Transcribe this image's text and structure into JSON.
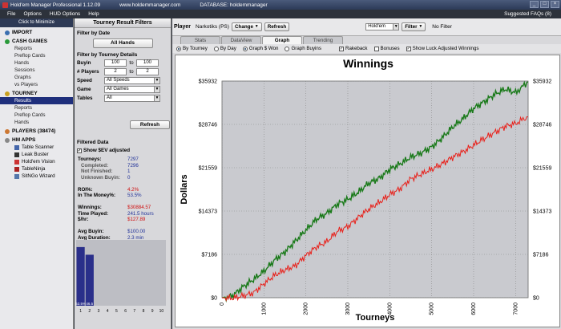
{
  "window": {
    "title": "Hold'em Manager Professional 1.12.09",
    "website": "www.holdemmanager.com",
    "database": "DATABASE: holdemmanager",
    "controls": [
      "_",
      "□",
      "×"
    ]
  },
  "menu": {
    "items": [
      "File",
      "Options",
      "HUD Options",
      "Help"
    ],
    "faq": "Suggested FAQs (8)"
  },
  "sidebar": {
    "minimize": "Click to Minimize",
    "sections": [
      {
        "label": "IMPORT",
        "color": "#3a6fb0",
        "items": []
      },
      {
        "label": "CASH GAMES",
        "color": "#2a9a3a",
        "items": [
          "Reports",
          "Preflop Cards",
          "Hands",
          "Sessions",
          "Graphs",
          "vs Players"
        ]
      },
      {
        "label": "TOURNEY",
        "color": "#c8a020",
        "items": [
          "Results",
          "Reports",
          "Preflop Cards",
          "Hands"
        ]
      },
      {
        "label": "PLAYERS (38474)",
        "color": "#cc7733",
        "items": []
      },
      {
        "label": "HM APPS",
        "color": "#888888",
        "items": []
      }
    ],
    "selected": "Results",
    "apps": [
      {
        "label": "Table Scanner",
        "color": "#4466aa"
      },
      {
        "label": "Leak Buster",
        "color": "#333333"
      },
      {
        "label": "Hold'em Vision",
        "color": "#cc3333"
      },
      {
        "label": "TableNinja",
        "color": "#aa2222"
      },
      {
        "label": "SitNGo Wizard",
        "color": "#5577aa"
      }
    ]
  },
  "filters": {
    "header": "Tourney Result Filters",
    "by_date": "Filter by Date",
    "all_hands": "All Hands",
    "details": "Filter by Tourney Details",
    "buyin_label": "Buyin",
    "buyin_from": "100",
    "buyin_to": "100",
    "players_label": "# Players",
    "players_from": "2",
    "players_to": "2",
    "to": "to",
    "speed_label": "Speed",
    "speed_value": "All Speeds",
    "game_label": "Game",
    "game_value": "All Games",
    "tables_label": "Tables",
    "tables_value": "All",
    "refresh": "Refresh"
  },
  "filtered_data": {
    "header": "Filtered Data",
    "show_sev": "Show $EV adjusted",
    "rows": [
      {
        "k": "Tourneys:",
        "v": "7297",
        "sub": false,
        "red": false
      },
      {
        "k": "Completed:",
        "v": "7296",
        "sub": true,
        "red": false
      },
      {
        "k": "Not Finished:",
        "v": "1",
        "sub": true,
        "red": false
      },
      {
        "k": "Unknown Buyin:",
        "v": "0",
        "sub": true,
        "red": false
      },
      {
        "k": "",
        "v": "",
        "sub": false,
        "red": false
      },
      {
        "k": "ROI%:",
        "v": "4.2%",
        "sub": false,
        "red": true
      },
      {
        "k": "In The Money%:",
        "v": "53.5%",
        "sub": false,
        "red": false
      },
      {
        "k": "",
        "v": "",
        "sub": false,
        "red": false
      },
      {
        "k": "Winnings:",
        "v": "$30884.57",
        "sub": false,
        "red": true
      },
      {
        "k": "Time Played:",
        "v": "241.5 hours",
        "sub": false,
        "red": false
      },
      {
        "k": "$/hr:",
        "v": "$127.89",
        "sub": false,
        "red": true
      },
      {
        "k": "",
        "v": "",
        "sub": false,
        "red": false
      },
      {
        "k": "Avg Buyin:",
        "v": "$100.00",
        "sub": false,
        "red": false
      },
      {
        "k": "Avg Duration:",
        "v": "2.3 min",
        "sub": false,
        "red": false
      }
    ],
    "finish_chart": {
      "type": "bar",
      "categories": [
        "1",
        "2",
        "3",
        "4",
        "5",
        "6",
        "7",
        "8",
        "9",
        "10"
      ],
      "values": [
        53.5,
        46.5,
        0,
        0,
        0,
        0,
        0,
        0,
        0,
        0
      ],
      "labels": [
        "53.5%",
        "46.5"
      ],
      "ylim": [
        0,
        60
      ],
      "color": "#2a2f8a"
    }
  },
  "toolbar": {
    "player_label": "Player",
    "player_name": "Narkotiks (PS)",
    "change": "Change",
    "refresh": "Refresh",
    "game": "Hold'em",
    "filter": "Filter",
    "no_filter": "No Filter"
  },
  "tabs": [
    "Stats",
    "DataView",
    "Graph",
    "Trending"
  ],
  "active_tab": "Graph",
  "options": {
    "by_tourney": "By Tourney",
    "by_day": "By Day",
    "graph_won": "Graph $ Won",
    "graph_buyins": "Graph Buyins",
    "rakeback": "Rakeback",
    "bonuses": "Bonuses",
    "luck": "Show Luck Adjusted Winnings"
  },
  "chart_data": {
    "type": "line",
    "title": "Winnings",
    "xlabel": "Tourneys",
    "ylabel": "Dollars",
    "xlim": [
      0,
      7300
    ],
    "ylim": [
      0,
      35932
    ],
    "x_ticks": [
      0,
      1000,
      2000,
      3000,
      4000,
      5000,
      6000,
      7000
    ],
    "y_ticks": [
      "$0",
      "$7186",
      "$14373",
      "$21559",
      "$28746",
      "$35932"
    ],
    "y_tick_values": [
      0,
      7186,
      14373,
      21559,
      28746,
      35932
    ],
    "grid": true,
    "series": [
      {
        "color": "#1a7a1a",
        "x": [
          0,
          250,
          500,
          750,
          1000,
          1250,
          1500,
          1750,
          2000,
          2250,
          2500,
          2750,
          3000,
          3250,
          3500,
          3750,
          4000,
          4250,
          4500,
          4750,
          5000,
          5250,
          5500,
          5750,
          6000,
          6250,
          6500,
          6750,
          7000,
          7297
        ],
        "y": [
          0,
          300,
          1800,
          3000,
          4400,
          6200,
          7600,
          9400,
          11200,
          13000,
          14000,
          15500,
          16300,
          17500,
          19000,
          19800,
          21300,
          22200,
          23300,
          24000,
          25000,
          26500,
          28300,
          29700,
          31400,
          32500,
          33700,
          34600,
          34000,
          35800
        ]
      },
      {
        "color": "#e8201a",
        "x": [
          0,
          250,
          500,
          750,
          1000,
          1250,
          1500,
          1750,
          2000,
          2250,
          2500,
          2750,
          3000,
          3250,
          3500,
          3750,
          4000,
          4250,
          4500,
          4750,
          5000,
          5250,
          5500,
          5750,
          6000,
          6250,
          6500,
          6750,
          7000,
          7297
        ],
        "y": [
          0,
          -100,
          300,
          800,
          2300,
          3700,
          4600,
          5300,
          7000,
          8400,
          9300,
          11000,
          11800,
          13300,
          14700,
          15800,
          17100,
          18100,
          19700,
          20500,
          21300,
          22200,
          23300,
          24200,
          25300,
          26400,
          27400,
          28400,
          28900,
          30000
        ]
      }
    ]
  }
}
